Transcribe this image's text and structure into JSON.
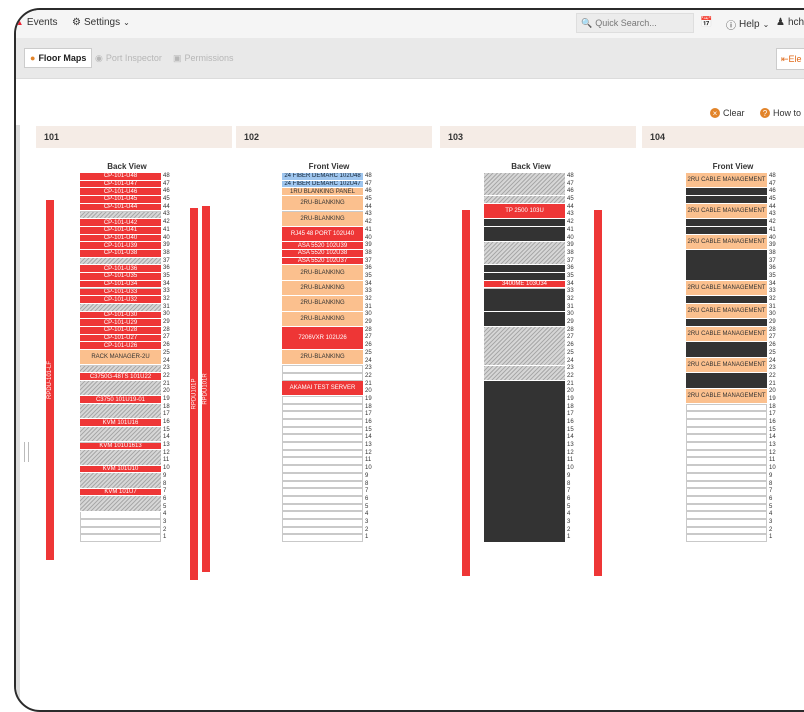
{
  "header": {
    "events_label": "Events",
    "settings_label": "Settings",
    "search_placeholder": "Quick Search...",
    "help_label": "Help",
    "user_label": "hch"
  },
  "toolbar": {
    "tabs": [
      {
        "label": "Floor Maps",
        "state": "active"
      },
      {
        "label": "Port Inspector",
        "state": "disabled"
      },
      {
        "label": "Permissions",
        "state": "disabled"
      }
    ],
    "elevation_label": "Ele"
  },
  "actions": {
    "clear_label": "Clear",
    "howto_label": "How to S"
  },
  "colors": {
    "red": "#ee3636",
    "orange": "#fbc08e",
    "blue": "#9fc6ef",
    "header_bg": "#f5ece6"
  },
  "racks": [
    {
      "name": "101",
      "view": "Back View",
      "pdus": [
        "RPDU-101-LF",
        "RPDU101P",
        "RPDU101R"
      ],
      "devices": [
        {
          "u": 48,
          "size": 1,
          "label": "CP-101-U48",
          "kind": "red"
        },
        {
          "u": 47,
          "size": 1,
          "label": "CP-101-U47",
          "kind": "red"
        },
        {
          "u": 46,
          "size": 1,
          "label": "CP-101-U46",
          "kind": "red"
        },
        {
          "u": 45,
          "size": 1,
          "label": "CP-101-U45",
          "kind": "red"
        },
        {
          "u": 44,
          "size": 1,
          "label": "CP-101-U44",
          "kind": "red"
        },
        {
          "u": 43,
          "size": 1,
          "label": "",
          "kind": "hatch"
        },
        {
          "u": 42,
          "size": 1,
          "label": "CP-101-U42",
          "kind": "red"
        },
        {
          "u": 41,
          "size": 1,
          "label": "CP-101-U41",
          "kind": "red"
        },
        {
          "u": 40,
          "size": 1,
          "label": "CP-101-U40",
          "kind": "red"
        },
        {
          "u": 39,
          "size": 1,
          "label": "CP-101-U39",
          "kind": "red"
        },
        {
          "u": 38,
          "size": 1,
          "label": "CP-101-U38",
          "kind": "red"
        },
        {
          "u": 37,
          "size": 1,
          "label": "",
          "kind": "hatch"
        },
        {
          "u": 36,
          "size": 1,
          "label": "CP-101-U36",
          "kind": "red"
        },
        {
          "u": 35,
          "size": 1,
          "label": "CP-101-U35",
          "kind": "red"
        },
        {
          "u": 34,
          "size": 1,
          "label": "CP-101-U34",
          "kind": "red"
        },
        {
          "u": 33,
          "size": 1,
          "label": "CP-101-U33",
          "kind": "red"
        },
        {
          "u": 32,
          "size": 1,
          "label": "CP-101-U32",
          "kind": "red"
        },
        {
          "u": 31,
          "size": 1,
          "label": "",
          "kind": "hatch"
        },
        {
          "u": 30,
          "size": 1,
          "label": "CP-101-U30",
          "kind": "red"
        },
        {
          "u": 29,
          "size": 1,
          "label": "CP-101-U29",
          "kind": "red"
        },
        {
          "u": 28,
          "size": 1,
          "label": "CP-101-U28",
          "kind": "red"
        },
        {
          "u": 27,
          "size": 1,
          "label": "CP-101-U27",
          "kind": "red"
        },
        {
          "u": 26,
          "size": 1,
          "label": "CP-101-U26",
          "kind": "red"
        },
        {
          "u": 25,
          "size": 2,
          "label": "RACK MANAGER-2U",
          "kind": "orange"
        },
        {
          "u": 23,
          "size": 1,
          "label": "",
          "kind": "hatch"
        },
        {
          "u": 22,
          "size": 1,
          "label": "C3750G-48TS 101U22",
          "kind": "red"
        },
        {
          "u": 21,
          "size": 2,
          "label": "",
          "kind": "hatch"
        },
        {
          "u": 19,
          "size": 1,
          "label": "C3750 101U19-01",
          "kind": "red"
        },
        {
          "u": 18,
          "size": 2,
          "label": "",
          "kind": "hatch"
        },
        {
          "u": 16,
          "size": 1,
          "label": "KVM 101U16",
          "kind": "red"
        },
        {
          "u": 15,
          "size": 2,
          "label": "",
          "kind": "hatch"
        },
        {
          "u": 13,
          "size": 1,
          "label": "KVM 101U1613",
          "kind": "red"
        },
        {
          "u": 12,
          "size": 2,
          "label": "",
          "kind": "hatch"
        },
        {
          "u": 10,
          "size": 1,
          "label": "KVM 101U10",
          "kind": "red"
        },
        {
          "u": 9,
          "size": 2,
          "label": "",
          "kind": "hatch"
        },
        {
          "u": 7,
          "size": 1,
          "label": "KVM 101U7",
          "kind": "red"
        },
        {
          "u": 6,
          "size": 2,
          "label": "",
          "kind": "hatch"
        }
      ]
    },
    {
      "name": "102",
      "view": "Front View",
      "pdus": [],
      "devices": [
        {
          "u": 48,
          "size": 1,
          "label": "24 FIBER DEMARC 102U48",
          "kind": "blue"
        },
        {
          "u": 47,
          "size": 1,
          "label": "24 FIBER DEMARC 102U47",
          "kind": "blue"
        },
        {
          "u": 46,
          "size": 1,
          "label": "1RU BLANKING PANEL",
          "kind": "orange"
        },
        {
          "u": 45,
          "size": 2,
          "label": "2RU-BLANKING",
          "kind": "orange"
        },
        {
          "u": 43,
          "size": 2,
          "label": "2RU-BLANKING",
          "kind": "orange"
        },
        {
          "u": 41,
          "size": 2,
          "label": "RJ45 48 PORT 102U40",
          "kind": "red"
        },
        {
          "u": 39,
          "size": 1,
          "label": "ASA 5520 102U39",
          "kind": "red"
        },
        {
          "u": 38,
          "size": 1,
          "label": "ASA 5520 102U38",
          "kind": "red"
        },
        {
          "u": 37,
          "size": 1,
          "label": "ASA 5520 102U37",
          "kind": "red"
        },
        {
          "u": 36,
          "size": 2,
          "label": "2RU-BLANKING",
          "kind": "orange"
        },
        {
          "u": 34,
          "size": 2,
          "label": "2RU-BLANKING",
          "kind": "orange"
        },
        {
          "u": 32,
          "size": 2,
          "label": "2RU-BLANKING",
          "kind": "orange"
        },
        {
          "u": 30,
          "size": 2,
          "label": "2RU-BLANKING",
          "kind": "orange"
        },
        {
          "u": 28,
          "size": 3,
          "label": "7206VXR 102U26",
          "kind": "red"
        },
        {
          "u": 25,
          "size": 2,
          "label": "2RU-BLANKING",
          "kind": "orange"
        },
        {
          "u": 21,
          "size": 2,
          "label": "AKAMAI TEST SERVER",
          "kind": "red"
        }
      ]
    },
    {
      "name": "103",
      "view": "Back View",
      "pdus": [],
      "devices": [
        {
          "u": 48,
          "size": 3,
          "label": "",
          "kind": "hatch"
        },
        {
          "u": 45,
          "size": 1,
          "label": "",
          "kind": "hatch"
        },
        {
          "u": 44,
          "size": 2,
          "label": "TP 2500 103U",
          "kind": "red"
        },
        {
          "u": 42,
          "size": 1,
          "label": "",
          "kind": "photo"
        },
        {
          "u": 41,
          "size": 2,
          "label": "",
          "kind": "photo"
        },
        {
          "u": 39,
          "size": 3,
          "label": "",
          "kind": "hatch"
        },
        {
          "u": 36,
          "size": 1,
          "label": "",
          "kind": "photo"
        },
        {
          "u": 35,
          "size": 1,
          "label": "",
          "kind": "photo"
        },
        {
          "u": 34,
          "size": 1,
          "label": "3400ME 103U34",
          "kind": "red"
        },
        {
          "u": 33,
          "size": 3,
          "label": "",
          "kind": "photo"
        },
        {
          "u": 30,
          "size": 2,
          "label": "",
          "kind": "photo"
        },
        {
          "u": 28,
          "size": 5,
          "label": "",
          "kind": "hatch"
        },
        {
          "u": 23,
          "size": 2,
          "label": "",
          "kind": "hatch"
        },
        {
          "u": 21,
          "size": 21,
          "label": "",
          "kind": "photo"
        }
      ]
    },
    {
      "name": "104",
      "view": "Front View",
      "pdus": [],
      "devices": [
        {
          "u": 48,
          "size": 2,
          "label": "2RU CABLE MANAGEMENT",
          "kind": "orange"
        },
        {
          "u": 46,
          "size": 1,
          "label": "",
          "kind": "photo"
        },
        {
          "u": 45,
          "size": 1,
          "label": "",
          "kind": "photo"
        },
        {
          "u": 44,
          "size": 2,
          "label": "2RU CABLE MANAGEMENT",
          "kind": "orange"
        },
        {
          "u": 42,
          "size": 1,
          "label": "",
          "kind": "photo"
        },
        {
          "u": 41,
          "size": 1,
          "label": "",
          "kind": "photo"
        },
        {
          "u": 40,
          "size": 2,
          "label": "2RU CABLE MANAGEMENT",
          "kind": "orange"
        },
        {
          "u": 38,
          "size": 4,
          "label": "",
          "kind": "photo"
        },
        {
          "u": 34,
          "size": 2,
          "label": "2RU CABLE MANAGEMENT",
          "kind": "orange"
        },
        {
          "u": 32,
          "size": 1,
          "label": "",
          "kind": "photo"
        },
        {
          "u": 31,
          "size": 2,
          "label": "2RU CABLE MANAGEMENT",
          "kind": "orange"
        },
        {
          "u": 29,
          "size": 1,
          "label": "",
          "kind": "photo"
        },
        {
          "u": 28,
          "size": 2,
          "label": "2RU CABLE MANAGEMENT",
          "kind": "orange"
        },
        {
          "u": 26,
          "size": 2,
          "label": "",
          "kind": "photo"
        },
        {
          "u": 24,
          "size": 2,
          "label": "2RU CABLE MANAGEMENT",
          "kind": "orange"
        },
        {
          "u": 22,
          "size": 2,
          "label": "",
          "kind": "photo"
        },
        {
          "u": 20,
          "size": 2,
          "label": "2RU CABLE MANAGEMENT",
          "kind": "orange"
        }
      ]
    }
  ]
}
